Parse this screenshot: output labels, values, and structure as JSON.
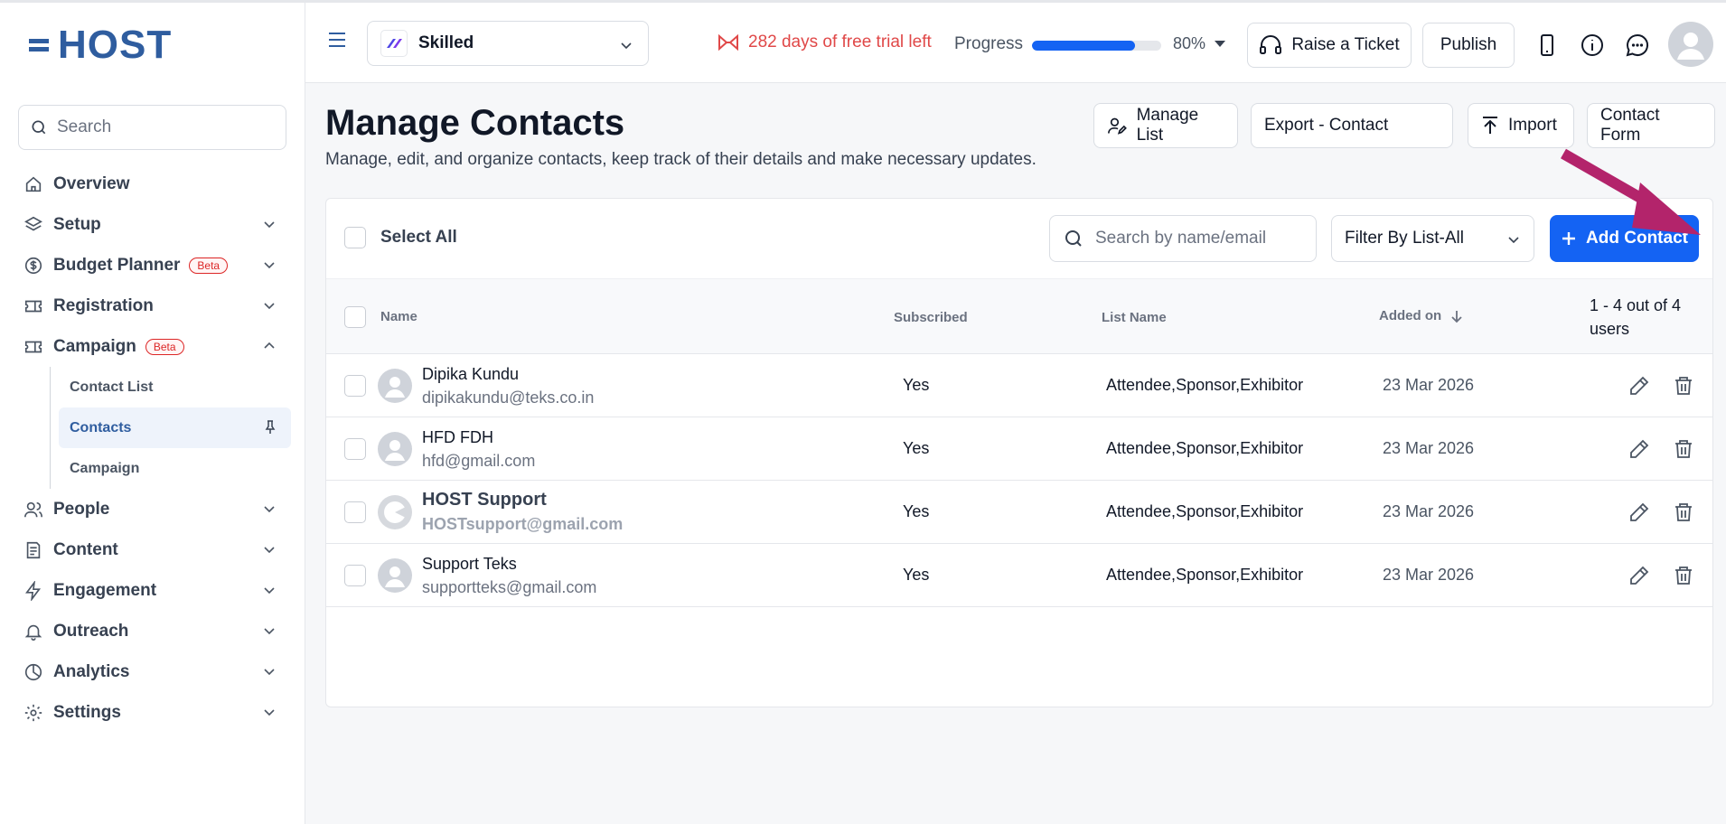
{
  "brand": {
    "logo_text": "HOST"
  },
  "sidebar": {
    "search_placeholder": "Search",
    "items": [
      {
        "label": "Overview",
        "icon": "home-icon"
      },
      {
        "label": "Setup",
        "icon": "layers-icon"
      },
      {
        "label": "Budget Planner",
        "icon": "dollar-circle-icon",
        "badge": "Beta"
      },
      {
        "label": "Registration",
        "icon": "ticket-icon"
      },
      {
        "label": "Campaign",
        "icon": "ticket-icon",
        "badge": "Beta",
        "expanded": true
      },
      {
        "label": "People",
        "icon": "users-icon"
      },
      {
        "label": "Content",
        "icon": "document-icon"
      },
      {
        "label": "Engagement",
        "icon": "bolt-icon"
      },
      {
        "label": "Outreach",
        "icon": "bell-icon"
      },
      {
        "label": "Analytics",
        "icon": "pie-chart-icon"
      },
      {
        "label": "Settings",
        "icon": "gear-icon"
      }
    ],
    "campaign_sub": [
      {
        "label": "Contact List"
      },
      {
        "label": "Contacts",
        "active": true
      },
      {
        "label": "Campaign"
      }
    ]
  },
  "topbar": {
    "event_name": "Skilled",
    "trial_text": "282 days of free trial left",
    "progress_label": "Progress",
    "progress_value": 0.8,
    "progress_text": "80%",
    "raise_ticket": "Raise a Ticket",
    "publish": "Publish"
  },
  "page": {
    "title": "Manage Contacts",
    "subtitle": "Manage, edit, and organize contacts, keep track of their details and make necessary updates.",
    "buttons": {
      "manage_list": "Manage List",
      "export": "Export - Contact",
      "import": "Import",
      "contact_form": "Contact Form"
    }
  },
  "table": {
    "select_all": "Select All",
    "search_placeholder": "Search by name/email",
    "filter": "Filter By List-All",
    "add_contact": "Add Contact",
    "columns": {
      "name": "Name",
      "subscribed": "Subscribed",
      "list_name": "List Name",
      "added_on": "Added on"
    },
    "count_text": "1 - 4 out of 4 users",
    "rows": [
      {
        "name": "Dipika Kundu",
        "email": "dipikakundu@teks.co.in",
        "subscribed": "Yes",
        "list": "Attendee,Sponsor,Exhibitor",
        "added": "23 Mar 2026"
      },
      {
        "name": "HFD FDH",
        "email": "hfd@gmail.com",
        "subscribed": "Yes",
        "list": "Attendee,Sponsor,Exhibitor",
        "added": "23 Mar 2026"
      },
      {
        "name": "HOST Support",
        "email": "HOSTsupport@gmail.com",
        "subscribed": "Yes",
        "list": "Attendee,Sponsor,Exhibitor",
        "added": "23 Mar 2026"
      },
      {
        "name": "Support Teks",
        "email": "supportteks@gmail.com",
        "subscribed": "Yes",
        "list": "Attendee,Sponsor,Exhibitor",
        "added": "23 Mar 2026"
      }
    ]
  },
  "colors": {
    "brand": "#2f5d9f",
    "primary": "#1463f3",
    "trial": "#e04848",
    "annotation_arrow": "#b3246b"
  }
}
